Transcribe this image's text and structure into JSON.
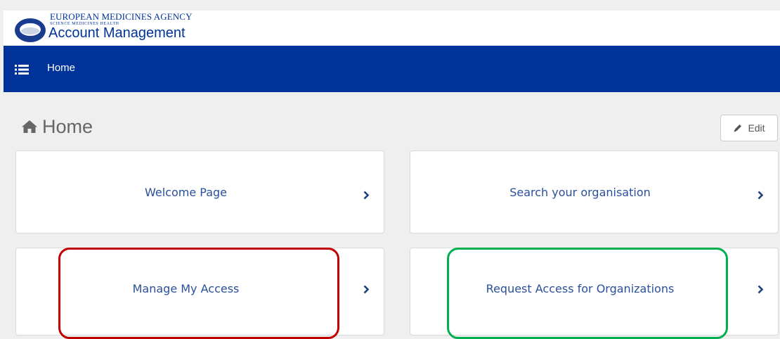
{
  "header": {
    "agency_name": "EUROPEAN MEDICINES AGENCY",
    "tagline": "SCIENCE  MEDICINES  HEALTH",
    "app_title": "Account Management"
  },
  "nav": {
    "home_label": "Home",
    "menu_icon": "list-icon"
  },
  "page": {
    "title": "Home",
    "title_icon": "home-icon",
    "edit_label": "Edit",
    "edit_icon": "pencil-icon"
  },
  "tiles": [
    {
      "label": "Welcome Page"
    },
    {
      "label": "Search your organisation"
    },
    {
      "label": "Manage My Access"
    },
    {
      "label": "Request Access for Organizations"
    }
  ],
  "annotations": {
    "manage_access_highlight_color": "#c00000",
    "request_access_highlight_color": "#00b050"
  },
  "colors": {
    "brand_blue": "#003399",
    "link_blue": "#2a4f9a",
    "background": "#efefef"
  }
}
